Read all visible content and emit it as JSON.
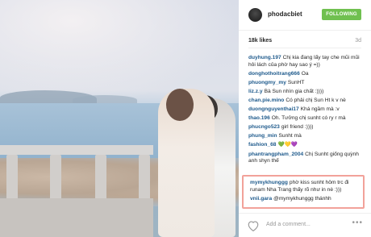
{
  "post": {
    "username": "phodacbiet",
    "follow_label": "FOLLOWING",
    "likes": "18k likes",
    "ago": "3d",
    "add_comment_placeholder": "Add a comment...",
    "more_icon": "more-icon",
    "heart_icon": "heart-icon"
  },
  "comments": [
    {
      "user": "duyhung.197",
      "text": "Chị kia đang lấy tay che mũi mũi hôi lách của phờ hay sao ý =))"
    },
    {
      "user": "donghothoitrang666",
      "text": "Oa"
    },
    {
      "user": "phuongmy_my",
      "text": "SunHT"
    },
    {
      "user": "liz.z.y",
      "text": "Bà Sun nhìn gia chất :))))"
    },
    {
      "user": "chan.pie.mino",
      "text": "Có phải chị Sun Ht k v nè"
    },
    {
      "user": "duongnguyenthai17",
      "text": "Khá ngầm mà :v"
    },
    {
      "user": "thao.196",
      "text": "Oh. Tưởng chị sunht có ry r mà"
    },
    {
      "user": "phucngo523",
      "text": "girl friend :))))"
    },
    {
      "user": "phung_min",
      "text": "Sunht mà"
    },
    {
      "user": "fashion_68",
      "text": "💚💛💜"
    },
    {
      "user": "phantrangpham_2004",
      "text": "Chị Sunht giống quỳnh anh shyn thế"
    }
  ],
  "highlighted_comments": [
    {
      "user": "mymykhunggg",
      "text": "phờ kiss sunht hôm trc đi runam Nha Trang thấy rõ như in nè :)))"
    },
    {
      "user": "vnii.gara",
      "text": "@mymykhunggg thánhh"
    }
  ],
  "colors": {
    "follow_button": "#70c050",
    "username_link": "#1e5a8c",
    "highlight_border": "#f2a29a"
  }
}
